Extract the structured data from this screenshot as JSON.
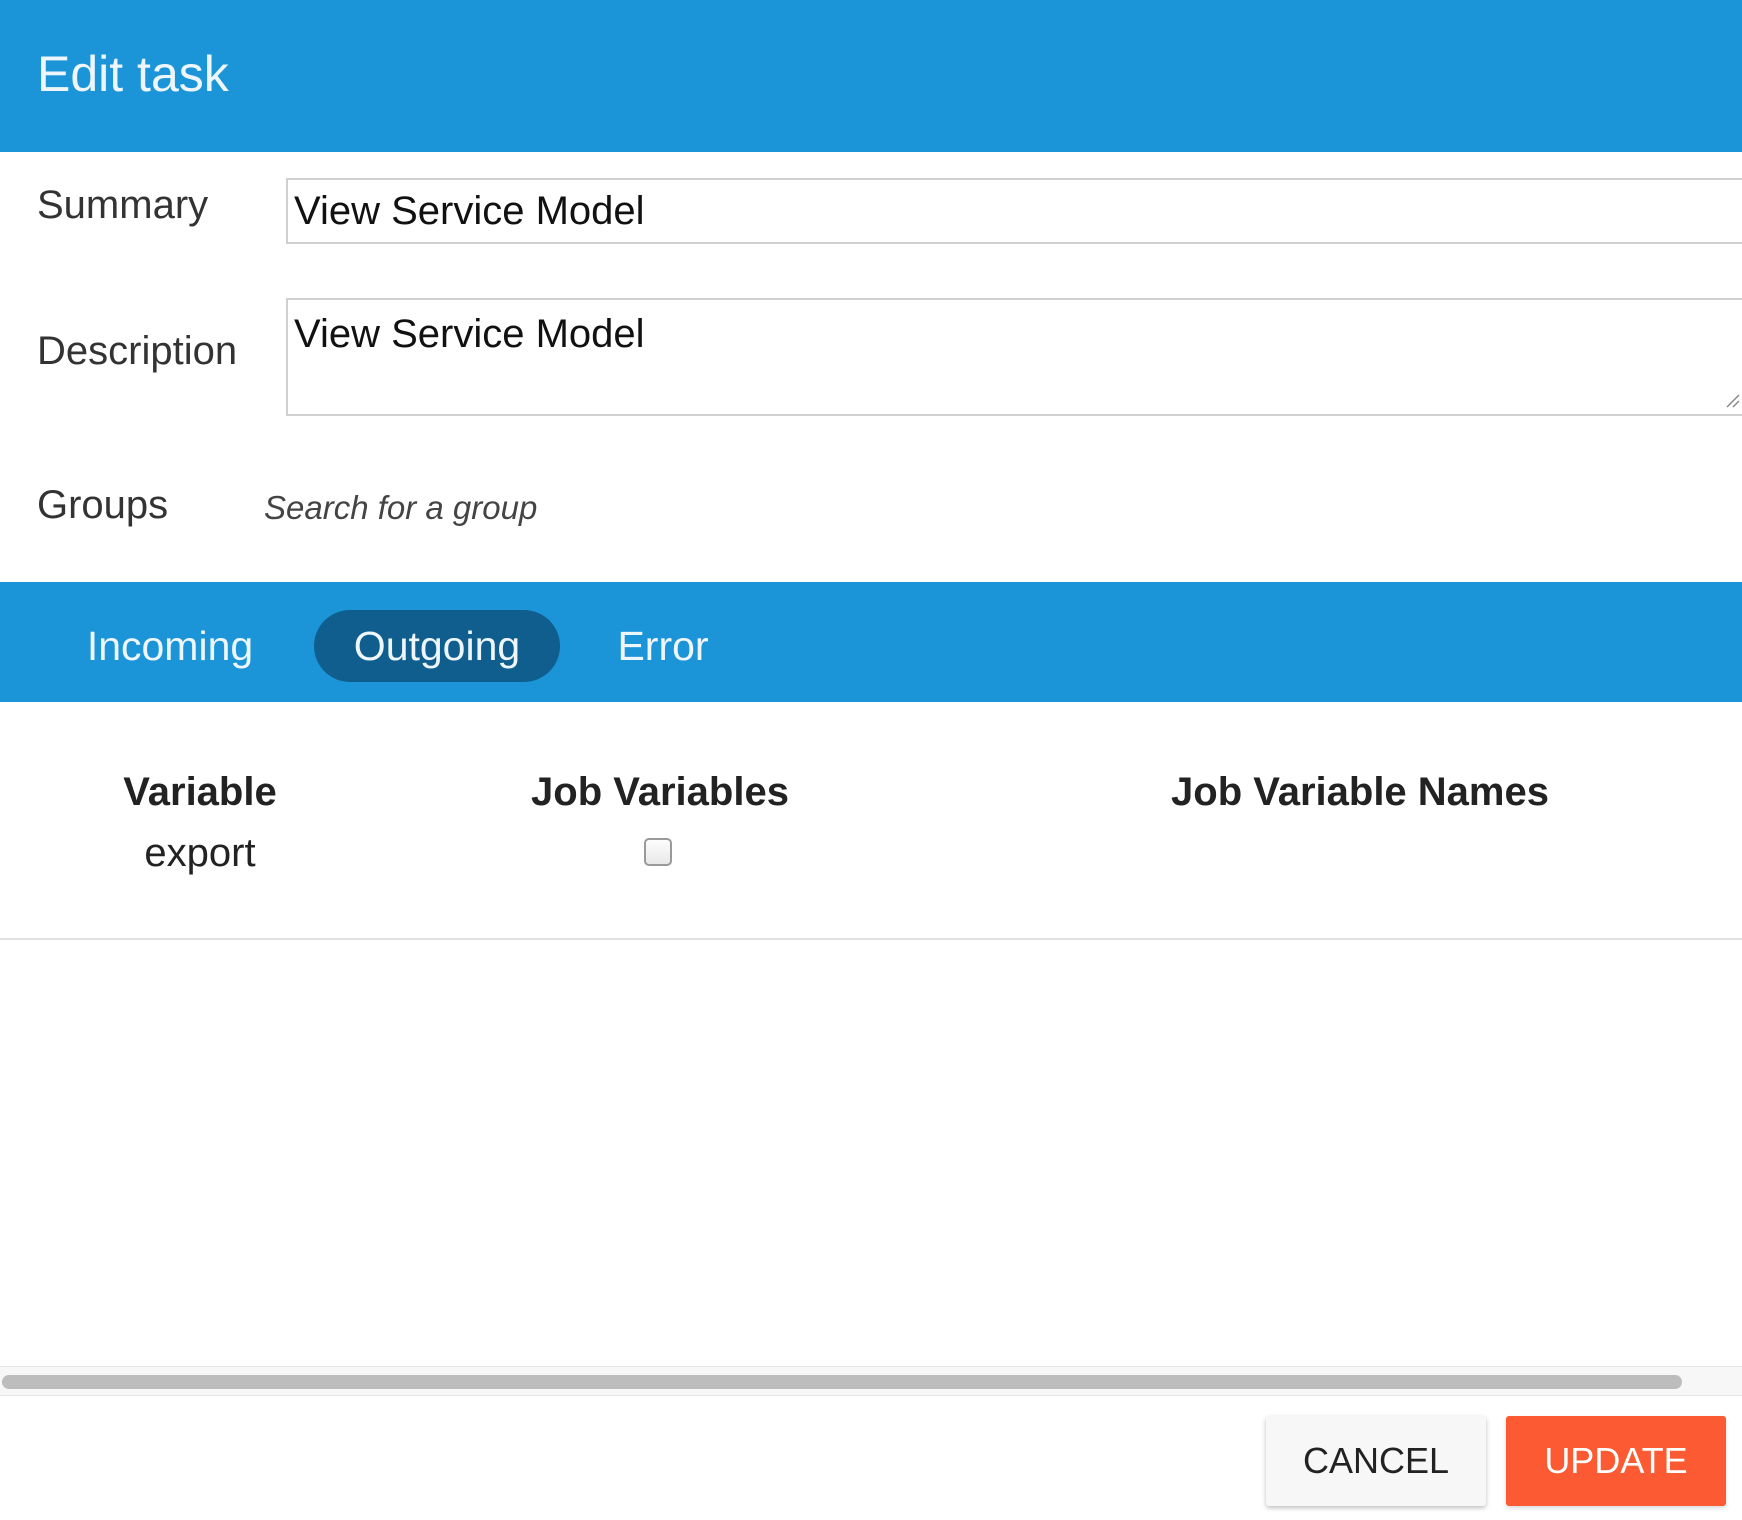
{
  "dialog": {
    "title": "Edit task"
  },
  "form": {
    "summary": {
      "label": "Summary",
      "value": "View Service Model"
    },
    "description": {
      "label": "Description",
      "value": "View Service Model"
    },
    "groups": {
      "label": "Groups",
      "placeholder": "Search for a group"
    }
  },
  "tabs": [
    {
      "label": "Incoming",
      "active": false
    },
    {
      "label": "Outgoing",
      "active": true
    },
    {
      "label": "Error",
      "active": false
    }
  ],
  "variables_table": {
    "columns": [
      "Variable",
      "Job Variables",
      "Job Variable Names"
    ],
    "rows": [
      {
        "variable": "export",
        "job_variables_checked": false,
        "job_variable_names": ""
      }
    ]
  },
  "footer": {
    "cancel_label": "CANCEL",
    "update_label": "UPDATE"
  },
  "colors": {
    "header_blue": "#1b95d8",
    "active_tab": "#0f5e8e",
    "update_button": "#fc5a32"
  }
}
